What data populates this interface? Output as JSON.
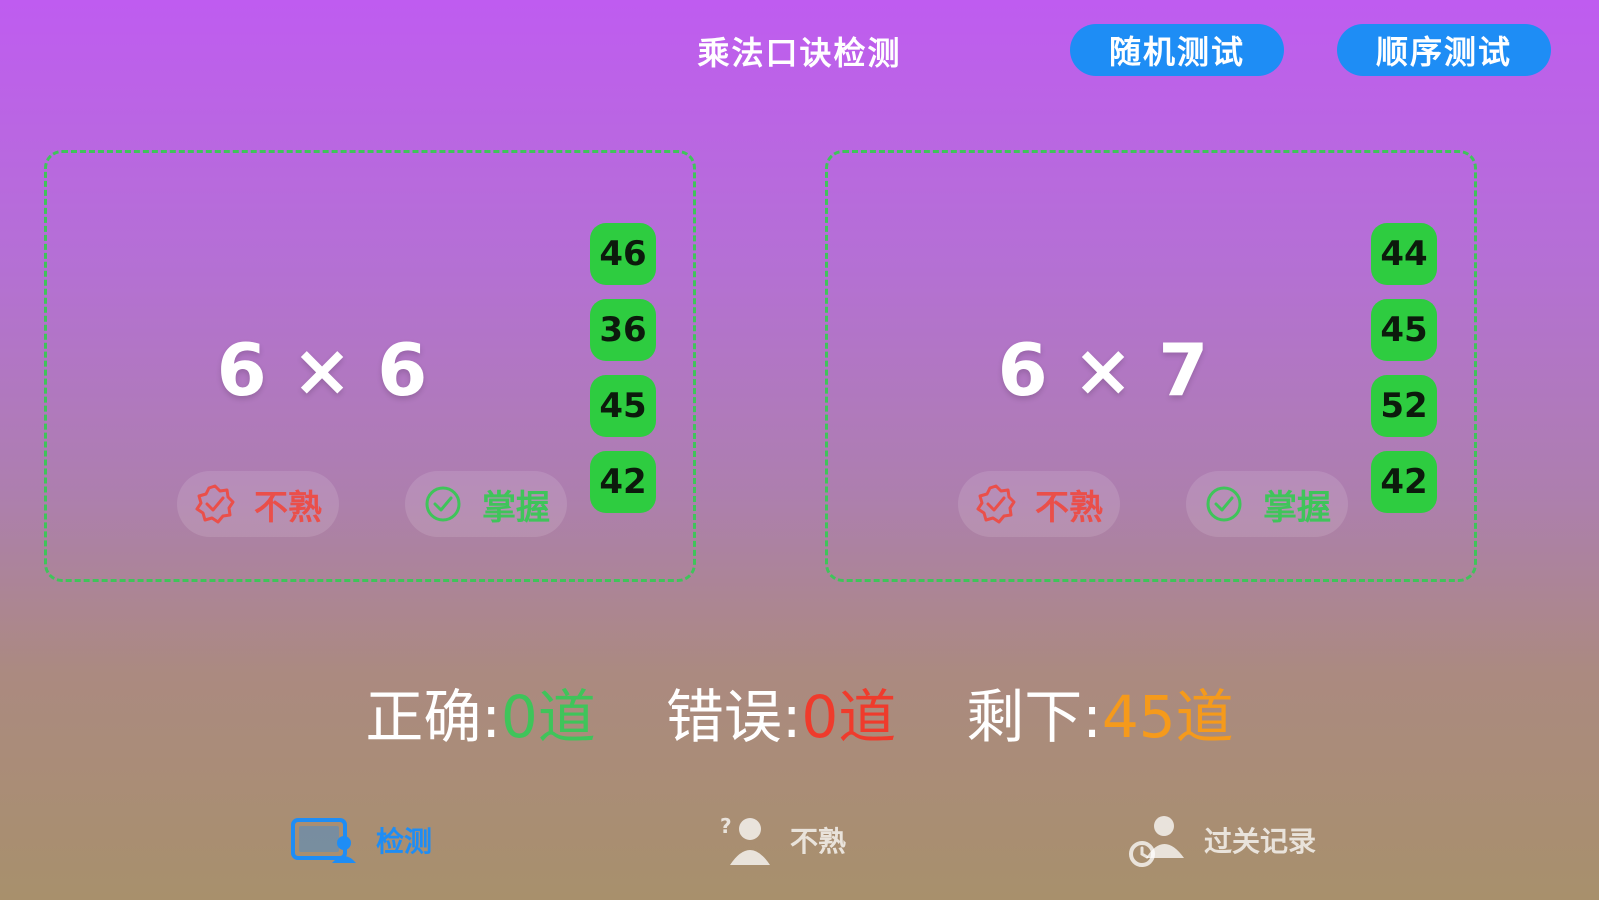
{
  "header": {
    "title": "乘法口诀检测",
    "random_label": "随机测试",
    "sequential_label": "顺序测试"
  },
  "cards": [
    {
      "question": "6 × 6",
      "options": [
        "46",
        "36",
        "45",
        "42"
      ],
      "unfamiliar_label": "不熟",
      "mastered_label": "掌握"
    },
    {
      "question": "6 × 7",
      "options": [
        "44",
        "45",
        "52",
        "42"
      ],
      "unfamiliar_label": "不熟",
      "mastered_label": "掌握"
    }
  ],
  "stats": {
    "correct_label": "正确:",
    "correct_value": "0道",
    "wrong_label": "错误:",
    "wrong_value": "0道",
    "remaining_label": "剩下:",
    "remaining_value": "45道"
  },
  "tabbar": {
    "tabs": [
      {
        "label": "检测",
        "icon": "monitor-person-icon",
        "active": true
      },
      {
        "label": "不熟",
        "icon": "question-person-icon",
        "active": false
      },
      {
        "label": "过关记录",
        "icon": "group-record-icon",
        "active": false
      }
    ]
  },
  "colors": {
    "accent": "#1e8df5",
    "option_green": "#2ecc40",
    "correct": "#3fc45a",
    "wrong": "#ef3b2c",
    "remaining": "#f59a1b"
  }
}
